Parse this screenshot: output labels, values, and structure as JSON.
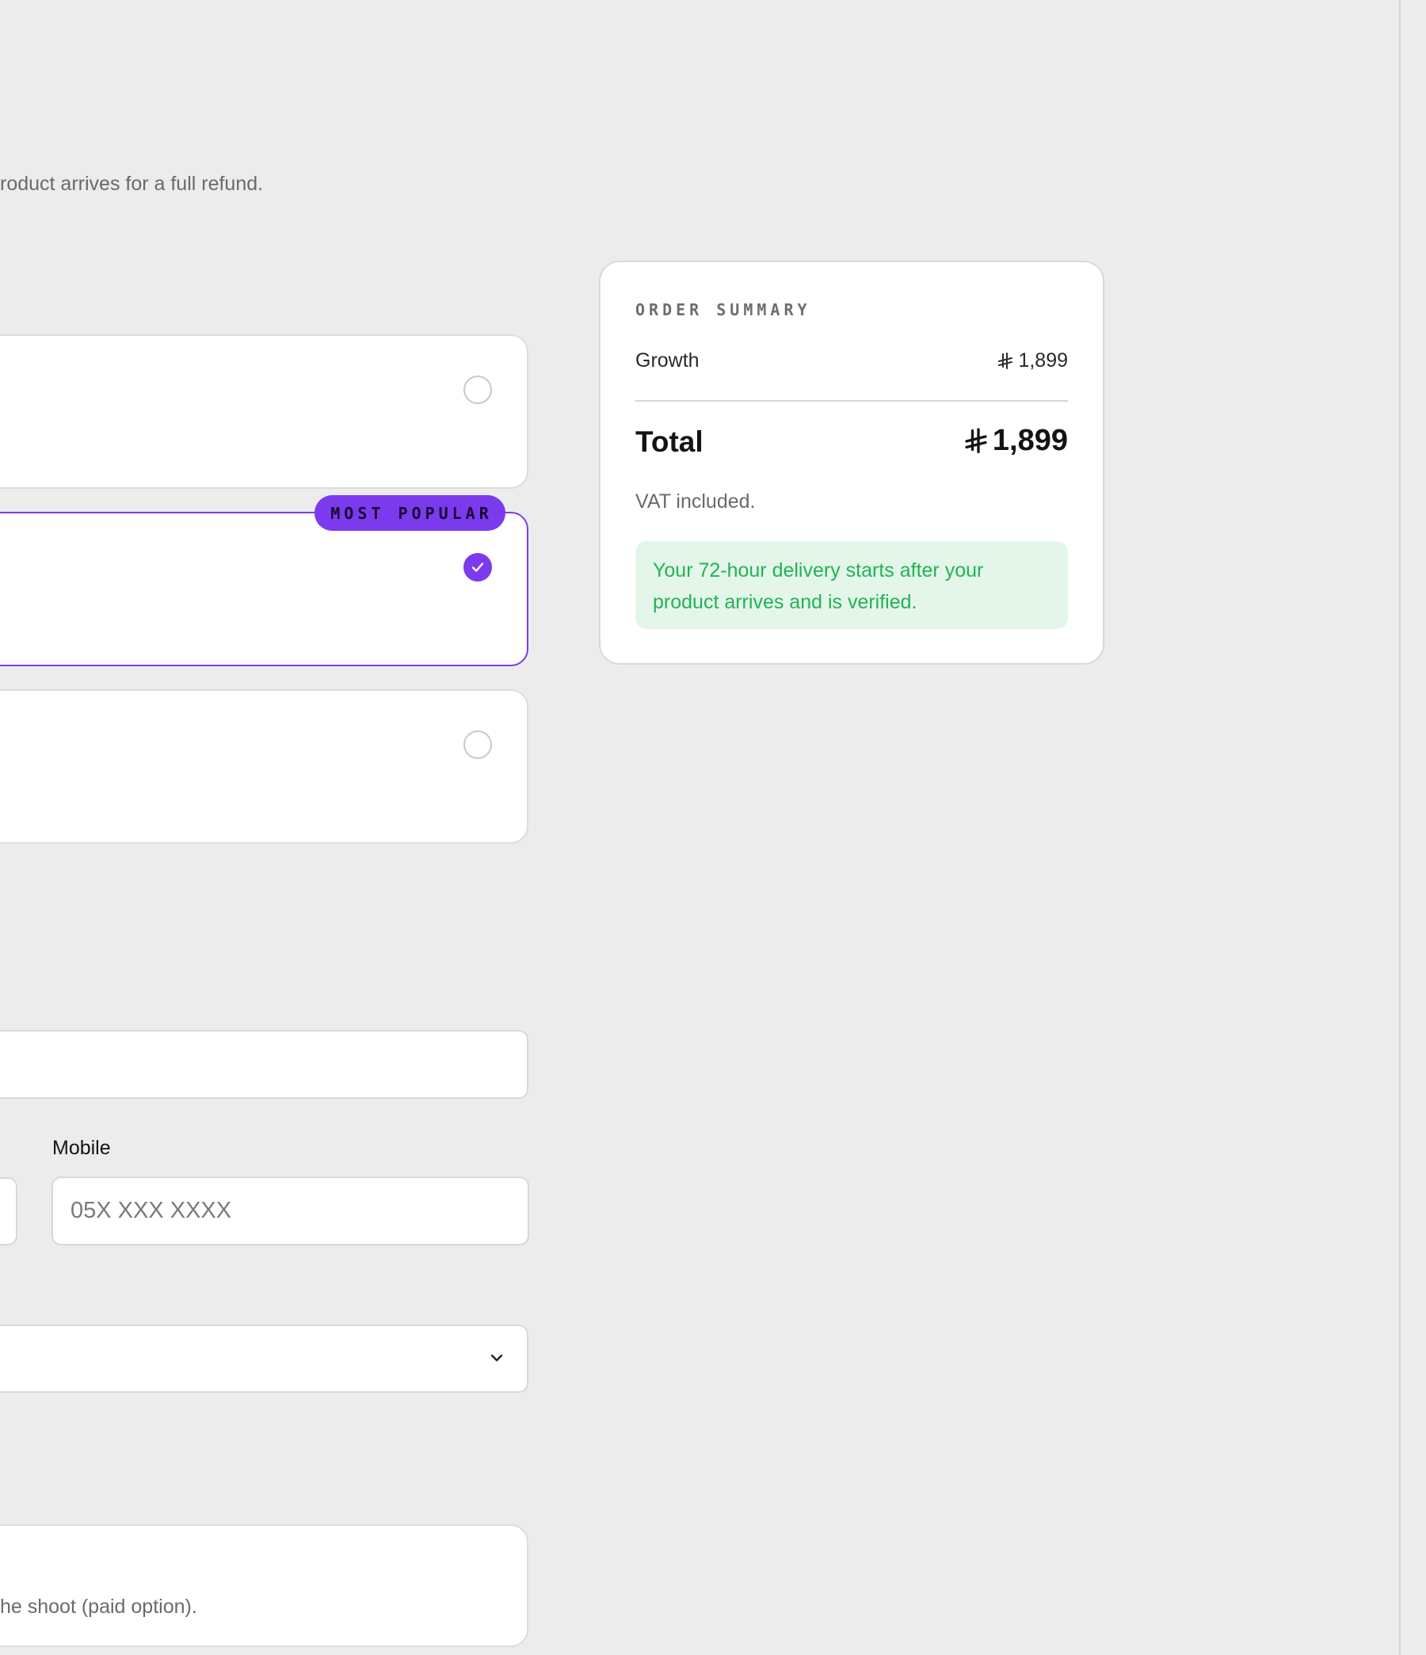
{
  "page": {
    "intro_text": "roduct arrives for a full refund."
  },
  "plans": {
    "badge": "MOST POPULAR",
    "selected_index": 1
  },
  "form": {
    "mobile_label": "Mobile",
    "mobile_placeholder": "05X XXX XXXX",
    "note_text": "he shoot (paid option)."
  },
  "order_summary": {
    "title": "ORDER SUMMARY",
    "item_label": "Growth",
    "item_price": "1,899",
    "total_label": "Total",
    "total_price": "1,899",
    "vat_note": "VAT included.",
    "delivery_note": "Your 72-hour delivery starts after your product arrives and is verified.",
    "currency_icon": "saudi-riyal-icon"
  },
  "colors": {
    "accent": "#7c3aed",
    "success_text": "#21b355",
    "success_bg": "#e4f6e9",
    "page_bg": "#ececec"
  }
}
